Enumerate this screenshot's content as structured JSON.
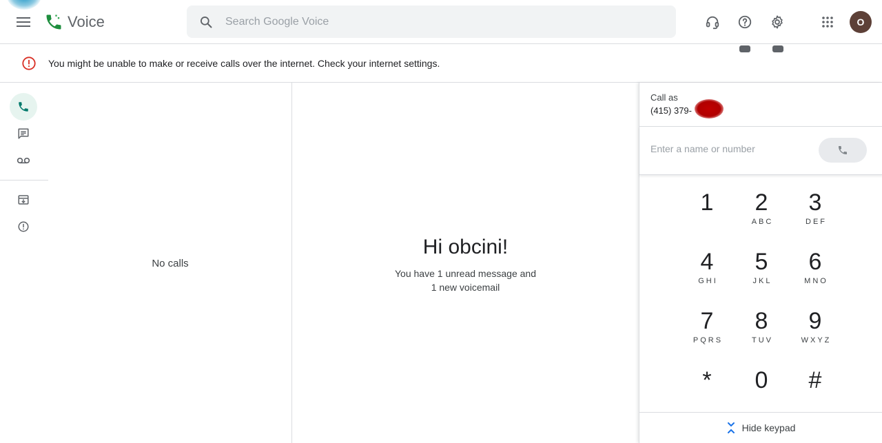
{
  "app": {
    "name": "Voice"
  },
  "search": {
    "placeholder": "Search Google Voice"
  },
  "header": {
    "avatar_initial": "O"
  },
  "banner": {
    "message": "You might be unable to make or receive calls over the internet. Check your internet settings."
  },
  "calls_panel": {
    "empty_text": "No calls"
  },
  "welcome": {
    "title": "Hi obcini!",
    "line1": "You have 1 unread message and",
    "line2": "1 new voicemail"
  },
  "dialer": {
    "call_as_label": "Call as",
    "call_as_number": "(415) 379-",
    "input_placeholder": "Enter a name or number",
    "keys": [
      {
        "digit": "1",
        "letters": ""
      },
      {
        "digit": "2",
        "letters": "ABC"
      },
      {
        "digit": "3",
        "letters": "DEF"
      },
      {
        "digit": "4",
        "letters": "GHI"
      },
      {
        "digit": "5",
        "letters": "JKL"
      },
      {
        "digit": "6",
        "letters": "MNO"
      },
      {
        "digit": "7",
        "letters": "PQRS"
      },
      {
        "digit": "8",
        "letters": "TUV"
      },
      {
        "digit": "9",
        "letters": "WXYZ"
      },
      {
        "digit": "*",
        "letters": ""
      },
      {
        "digit": "0",
        "letters": ""
      },
      {
        "digit": "#",
        "letters": ""
      }
    ],
    "hide_keypad_label": "Hide keypad"
  },
  "colors": {
    "brand_green": "#1e8e3e",
    "active_nav_bg": "#e6f4ef",
    "active_icon": "#00796b",
    "error_red": "#d93025",
    "accent_blue": "#1a73e8",
    "avatar_bg": "#5d4037"
  },
  "icons": {
    "menu": "hamburger-icon",
    "logo": "voice-phone-logo-icon",
    "search": "search-icon",
    "support": "headset-icon",
    "help": "help-icon",
    "settings": "gear-icon",
    "apps": "apps-grid-icon",
    "banner": "error-circle-icon",
    "nav_calls": "phone-icon",
    "nav_messages": "message-icon",
    "nav_voicemail": "voicemail-icon",
    "nav_archive": "archive-icon",
    "nav_spam": "spam-icon",
    "call": "phone-icon",
    "hide_keypad": "collapse-chevrons-icon"
  }
}
